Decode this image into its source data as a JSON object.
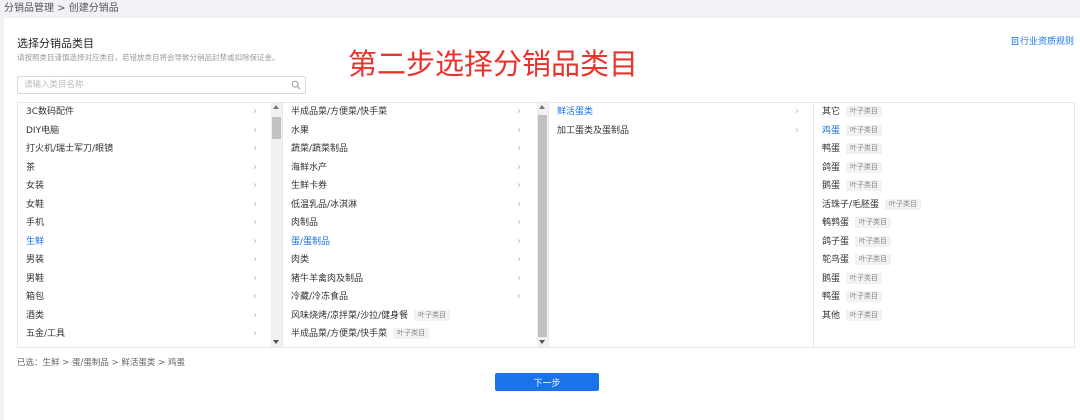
{
  "breadcrumb": "分销品管理 > 创建分销品",
  "title": "选择分销品类目",
  "subtitle": "请按照类目谨慎选择对应类目，若错放类目将会导致分销品封禁或扣除保证金。",
  "qualification_link": "行业资质规则",
  "annotation": "第二步选择分销品类目",
  "search": {
    "placeholder": "请输入类目名称"
  },
  "tag_label": "叶子类目",
  "columns": [
    {
      "items": [
        {
          "label": "3C数码配件",
          "has_children": true
        },
        {
          "label": "DIY电脑",
          "has_children": true
        },
        {
          "label": "打火机/瑞士军刀/眼镜",
          "has_children": true
        },
        {
          "label": "茶",
          "has_children": true
        },
        {
          "label": "女装",
          "has_children": true
        },
        {
          "label": "女鞋",
          "has_children": true
        },
        {
          "label": "手机",
          "has_children": true
        },
        {
          "label": "生鲜",
          "has_children": true,
          "selected": true
        },
        {
          "label": "男装",
          "has_children": true
        },
        {
          "label": "男鞋",
          "has_children": true
        },
        {
          "label": "箱包",
          "has_children": true
        },
        {
          "label": "酒类",
          "has_children": true
        },
        {
          "label": "五金/工具",
          "has_children": true
        }
      ]
    },
    {
      "items": [
        {
          "label": "半成品菜/方便菜/快手菜",
          "has_children": true
        },
        {
          "label": "水果",
          "has_children": true
        },
        {
          "label": "蔬菜/蔬菜制品",
          "has_children": true
        },
        {
          "label": "海鲜水产",
          "has_children": true
        },
        {
          "label": "生鲜卡券",
          "has_children": true
        },
        {
          "label": "低温乳品/冰淇淋",
          "has_children": true
        },
        {
          "label": "肉制品",
          "has_children": true
        },
        {
          "label": "蛋/蛋制品",
          "has_children": true,
          "selected": true
        },
        {
          "label": "肉类",
          "has_children": true
        },
        {
          "label": "猪牛羊禽肉及制品",
          "has_children": true
        },
        {
          "label": "冷藏/冷冻食品",
          "has_children": true
        },
        {
          "label": "风味烧烤/凉拌菜/沙拉/健身餐",
          "leaf": true
        },
        {
          "label": "半成品菜/方便菜/快手菜",
          "leaf": true
        }
      ]
    },
    {
      "items": [
        {
          "label": "鲜活蛋类",
          "has_children": true,
          "selected": true
        },
        {
          "label": "加工蛋类及蛋制品",
          "has_children": true
        }
      ]
    },
    {
      "items": [
        {
          "label": "其它",
          "leaf": true
        },
        {
          "label": "鸡蛋",
          "leaf": true,
          "selected": true
        },
        {
          "label": "鸭蛋",
          "leaf": true
        },
        {
          "label": "鸽蛋",
          "leaf": true
        },
        {
          "label": "鹅蛋",
          "leaf": true
        },
        {
          "label": "活珠子/毛胚蛋",
          "leaf": true
        },
        {
          "label": "鹌鹑蛋",
          "leaf": true
        },
        {
          "label": "鸽子蛋",
          "leaf": true
        },
        {
          "label": "鸵鸟蛋",
          "leaf": true
        },
        {
          "label": "鹅蛋",
          "leaf": true
        },
        {
          "label": "鸭蛋",
          "leaf": true
        },
        {
          "label": "其他",
          "leaf": true
        }
      ]
    }
  ],
  "selected_path": "已选：生鲜 > 蛋/蛋制品 > 鲜活蛋类 > 鸡蛋",
  "next_button": "下一步",
  "colors": {
    "accent": "#1a73e8",
    "annotation": "#e8342c"
  },
  "icons": {
    "search": "search-icon",
    "link": "document-icon",
    "chevron": "chevron-right-icon"
  }
}
